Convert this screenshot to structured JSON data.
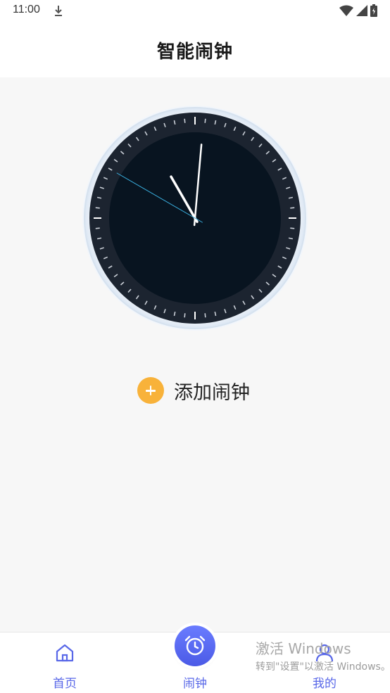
{
  "status_bar": {
    "time": "11:00"
  },
  "header": {
    "title": "智能闹钟"
  },
  "clock": {
    "hour_hand_angle_deg": -30,
    "minute_hand_angle_deg": 5,
    "second_hand_angle_deg": -60,
    "colors": {
      "face": "#081420",
      "ring": "#1c2430",
      "tick": "#c9ced6",
      "hand": "#ffffff",
      "second_hand": "#3ab0e0",
      "bezel": "#e4edf7"
    }
  },
  "add_alarm": {
    "label": "添加闹钟",
    "color": "#f8b23a"
  },
  "bottom_nav": {
    "items": [
      {
        "label": "首页",
        "icon": "home-icon"
      },
      {
        "label": "闹钟",
        "icon": "alarm-clock-icon"
      },
      {
        "label": "我的",
        "icon": "person-icon"
      }
    ],
    "accent": "#5867e8"
  },
  "watermark": {
    "line1": "激活 Windows",
    "line2": "转到\"设置\"以激活 Windows。"
  }
}
